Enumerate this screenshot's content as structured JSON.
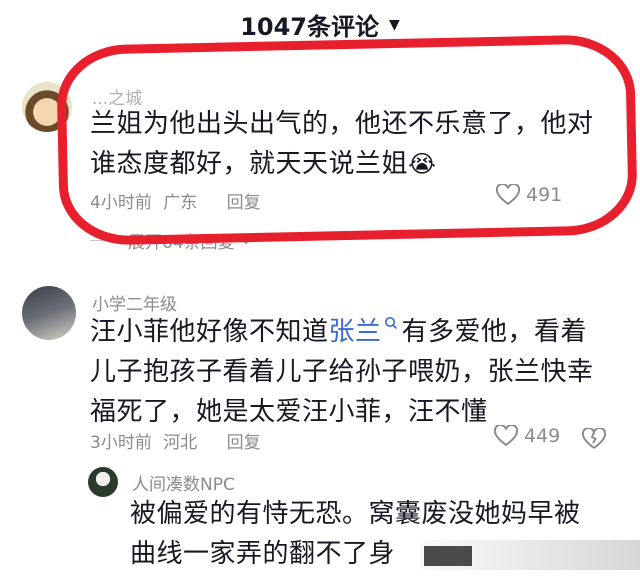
{
  "header": {
    "title": "1047条评论",
    "caret_icon": "caret-down-icon"
  },
  "comments": [
    {
      "username": "...之城",
      "text": "兰姐为他出头出气的，他还不乐意了，他对谁态度都好，就天天说兰姐",
      "emoji": "😭",
      "time": "4小时前",
      "location": "广东",
      "reply_label": "回复",
      "likes": "491",
      "expand_label": "展开64条回复"
    },
    {
      "username": "小学二年级",
      "text_before": "汪小菲他好像不知道",
      "mention": "张兰",
      "text_after": "有多爱他，看着儿子抱孩子看着儿子给孙子喂奶，张兰快幸福死了，她是太爱汪小菲，汪不懂",
      "time": "3小时前",
      "location": "河北",
      "reply_label": "回复",
      "likes": "449"
    },
    {
      "username": "人间凑数NPC",
      "text": "被偏爱的有恃无恐。窝囊废没她妈早被曲线一家弄的翻不了身"
    }
  ],
  "colors": {
    "ring": "#e8202e",
    "mention": "#3a6ad6",
    "meta": "#8a8b91"
  }
}
